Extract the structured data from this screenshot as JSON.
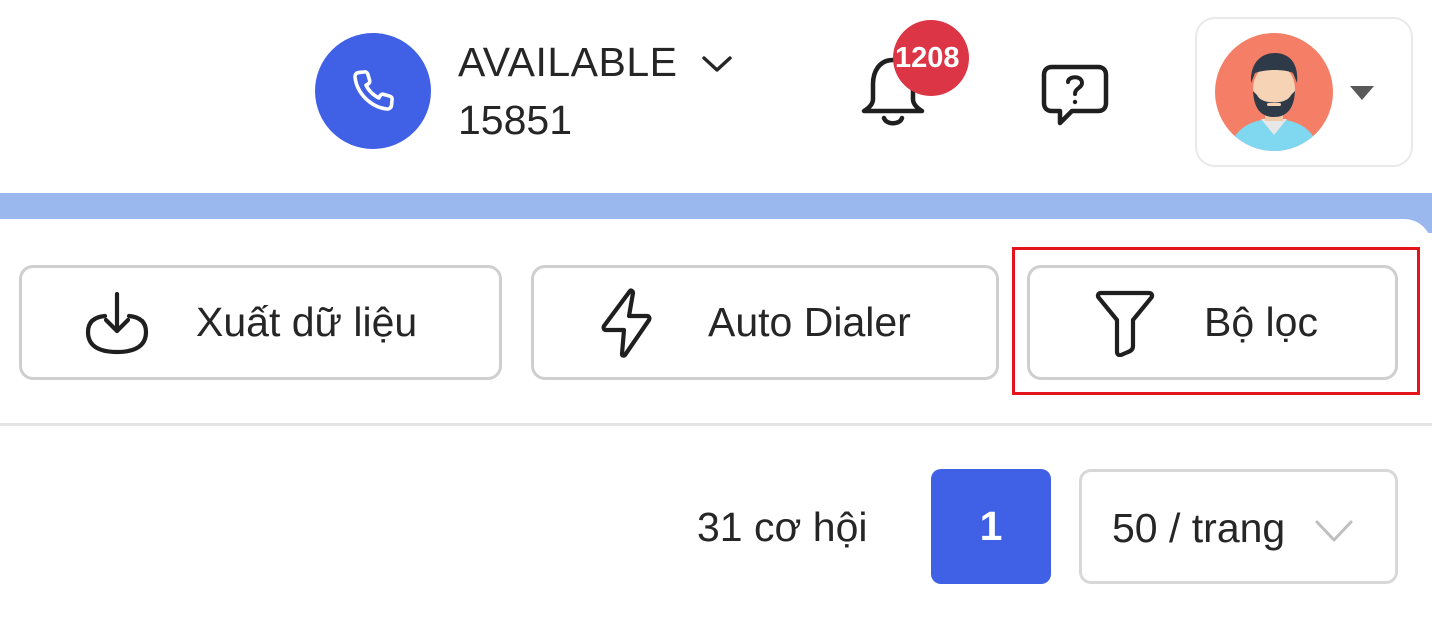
{
  "header": {
    "status": "AVAILABLE",
    "extension": "15851",
    "notification_count": "1208",
    "icons": {
      "phone": "phone-icon",
      "status_dropdown": "chevron-down-icon",
      "bell": "bell-icon",
      "help": "help-chat-icon",
      "avatar": "avatar",
      "avatar_menu": "caret-down-icon"
    }
  },
  "actions": {
    "export_label": "Xuất dữ liệu",
    "autodialer_label": "Auto Dialer",
    "filter_label": "Bộ lọc"
  },
  "pagination": {
    "total": "31 cơ hội",
    "current_page": "1",
    "page_size": "50 / trang"
  },
  "colors": {
    "primary": "#4060e6",
    "badge": "#dc3545",
    "band": "#9bb8ee",
    "highlight": "#e4141c"
  }
}
